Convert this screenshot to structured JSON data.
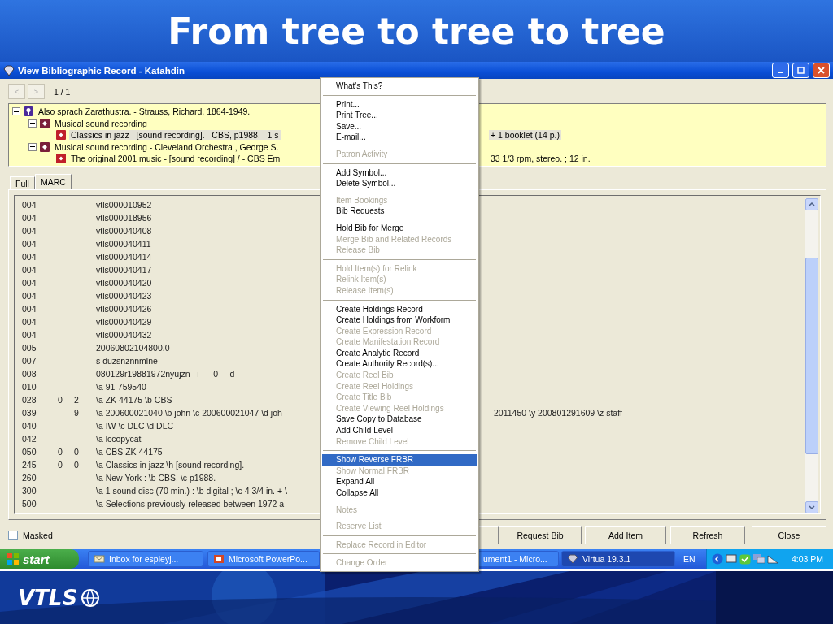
{
  "slide_title": "From tree to tree to tree",
  "window": {
    "title": "View Bibliographic Record - Katahdin"
  },
  "navigation": {
    "previous": "<",
    "next": ">",
    "position": "1 / 1"
  },
  "tree": [
    {
      "kind": "work",
      "text": "Also sprach Zarathustra. - Strauss, Richard, 1864-1949.",
      "expanded": true,
      "selected": false,
      "children": [
        {
          "kind": "expression",
          "text": "Musical sound recording",
          "expanded": true,
          "selected": false,
          "children": [
            {
              "kind": "manifestation",
              "text": "Classics in jazz   [sound recording].   CBS, p1988.   1 s",
              "continued_text": "+ 1 booklet (14 p.)",
              "selected": true
            }
          ]
        },
        {
          "kind": "expression",
          "text": "Musical sound recording - Cleveland Orchestra , George S.",
          "expanded": true,
          "selected": false,
          "children": [
            {
              "kind": "manifestation",
              "text": "The original 2001 music - [sound recording] / - CBS Em",
              "continued_text": "33 1/3 rpm, stereo. ; 12 in.",
              "selected": false
            }
          ]
        }
      ]
    }
  ],
  "tabs": [
    {
      "label": "Full",
      "selected": false
    },
    {
      "label": "MARC",
      "selected": true
    }
  ],
  "marc_rows": [
    {
      "tag": "004",
      "value": "vtls000010952"
    },
    {
      "tag": "004",
      "value": "vtls000018956"
    },
    {
      "tag": "004",
      "value": "vtls000040408"
    },
    {
      "tag": "004",
      "value": "vtls000040411"
    },
    {
      "tag": "004",
      "value": "vtls000040414"
    },
    {
      "tag": "004",
      "value": "vtls000040417"
    },
    {
      "tag": "004",
      "value": "vtls000040420"
    },
    {
      "tag": "004",
      "value": "vtls000040423"
    },
    {
      "tag": "004",
      "value": "vtls000040426"
    },
    {
      "tag": "004",
      "value": "vtls000040429"
    },
    {
      "tag": "004",
      "value": "vtls000040432"
    },
    {
      "tag": "005",
      "value": "20060802104800.0"
    },
    {
      "tag": "007",
      "value": "s duzsnznnmlne"
    },
    {
      "tag": "008",
      "value": "080129r19881972nyujzn   i      0     d"
    },
    {
      "tag": "010",
      "value": "\\a 91-759540"
    },
    {
      "tag": "028",
      "ind1": "0",
      "ind2": "2",
      "value": "\\a ZK 44175 \\b CBS"
    },
    {
      "tag": "039",
      "ind2": "9",
      "value": "\\a 200600021040 \\b john \\c 200600021047 \\d joh",
      "continued_value": "2011450 \\y 200801291609 \\z staff"
    },
    {
      "tag": "040",
      "value": "\\a IW \\c DLC \\d DLC"
    },
    {
      "tag": "042",
      "value": "\\a lccopycat"
    },
    {
      "tag": "050",
      "ind1": "0",
      "ind2": "0",
      "value": "\\a CBS ZK 44175"
    },
    {
      "tag": "245",
      "ind1": "0",
      "ind2": "0",
      "value": "\\a Classics in jazz \\h [sound recording]."
    },
    {
      "tag": "260",
      "value": "\\a New York : \\b CBS, \\c p1988."
    },
    {
      "tag": "300",
      "value": "\\a 1 sound disc (70 min.) : \\b digital ; \\c 4 3/4 in. + \\"
    },
    {
      "tag": "500",
      "value": "\\a Selections previously released between 1972 a"
    }
  ],
  "masked": {
    "label": "Masked",
    "checked": false
  },
  "buttons": [
    "Request Bib",
    "Add Item",
    "Refresh",
    "Close"
  ],
  "context_menu": [
    {
      "kind": "item",
      "label": "What's This?",
      "disabled": false,
      "selected": false
    },
    {
      "kind": "separator"
    },
    {
      "kind": "item",
      "label": "Print...",
      "disabled": false,
      "selected": false
    },
    {
      "kind": "item",
      "label": "Print Tree...",
      "disabled": false,
      "selected": false
    },
    {
      "kind": "item",
      "label": "Save...",
      "disabled": false,
      "selected": false
    },
    {
      "kind": "item",
      "label": "E-mail...",
      "disabled": false,
      "selected": false
    },
    {
      "kind": "gap"
    },
    {
      "kind": "item",
      "label": "Patron Activity",
      "disabled": true,
      "selected": false
    },
    {
      "kind": "separator"
    },
    {
      "kind": "item",
      "label": "Add Symbol...",
      "disabled": false,
      "selected": false
    },
    {
      "kind": "item",
      "label": "Delete Symbol...",
      "disabled": false,
      "selected": false
    },
    {
      "kind": "gap"
    },
    {
      "kind": "item",
      "label": "Item Bookings",
      "disabled": true,
      "selected": false
    },
    {
      "kind": "item",
      "label": "Bib Requests",
      "disabled": false,
      "selected": false
    },
    {
      "kind": "gap"
    },
    {
      "kind": "item",
      "label": "Hold Bib for Merge",
      "disabled": false,
      "selected": false
    },
    {
      "kind": "item",
      "label": "Merge Bib and Related Records",
      "disabled": true,
      "selected": false
    },
    {
      "kind": "item",
      "label": "Release Bib",
      "disabled": true,
      "selected": false
    },
    {
      "kind": "separator"
    },
    {
      "kind": "item",
      "label": "Hold Item(s) for Relink",
      "disabled": true,
      "selected": false
    },
    {
      "kind": "item",
      "label": "Relink Item(s)",
      "disabled": true,
      "selected": false
    },
    {
      "kind": "item",
      "label": "Release Item(s)",
      "disabled": true,
      "selected": false
    },
    {
      "kind": "separator"
    },
    {
      "kind": "item",
      "label": "Create Holdings Record",
      "disabled": false,
      "selected": false
    },
    {
      "kind": "item",
      "label": "Create Holdings from Workform",
      "disabled": false,
      "selected": false
    },
    {
      "kind": "item",
      "label": "Create Expression Record",
      "disabled": true,
      "selected": false
    },
    {
      "kind": "item",
      "label": "Create Manifestation Record",
      "disabled": true,
      "selected": false
    },
    {
      "kind": "item",
      "label": "Create Analytic Record",
      "disabled": false,
      "selected": false
    },
    {
      "kind": "item",
      "label": "Create Authority Record(s)...",
      "disabled": false,
      "selected": false
    },
    {
      "kind": "item",
      "label": "Create Reel Bib",
      "disabled": true,
      "selected": false
    },
    {
      "kind": "item",
      "label": "Create Reel Holdings",
      "disabled": true,
      "selected": false
    },
    {
      "kind": "item",
      "label": "Create Title Bib",
      "disabled": true,
      "selected": false
    },
    {
      "kind": "item",
      "label": "Create Viewing Reel Holdings",
      "disabled": true,
      "selected": false
    },
    {
      "kind": "item",
      "label": "Save Copy to Database",
      "disabled": false,
      "selected": false
    },
    {
      "kind": "item",
      "label": "Add Child Level",
      "disabled": false,
      "selected": false
    },
    {
      "kind": "item",
      "label": "Remove Child Level",
      "disabled": true,
      "selected": false
    },
    {
      "kind": "separator"
    },
    {
      "kind": "item",
      "label": "Show Reverse FRBR",
      "disabled": false,
      "selected": true
    },
    {
      "kind": "item",
      "label": "Show Normal FRBR",
      "disabled": true,
      "selected": false
    },
    {
      "kind": "item",
      "label": "Expand All",
      "disabled": false,
      "selected": false
    },
    {
      "kind": "item",
      "label": "Collapse All",
      "disabled": false,
      "selected": false
    },
    {
      "kind": "gap"
    },
    {
      "kind": "item",
      "label": "Notes",
      "disabled": true,
      "selected": false
    },
    {
      "kind": "gap"
    },
    {
      "kind": "item",
      "label": "Reserve List",
      "disabled": true,
      "selected": false
    },
    {
      "kind": "separator"
    },
    {
      "kind": "item",
      "label": "Replace Record in Editor",
      "disabled": true,
      "selected": false
    },
    {
      "kind": "separator"
    },
    {
      "kind": "item",
      "label": "Change Order",
      "disabled": true,
      "selected": false
    }
  ],
  "taskbar": {
    "start": "start",
    "tasks": [
      {
        "label": "Inbox for espleyj...",
        "selected": false
      },
      {
        "label": "Microsoft PowerPo...",
        "selected": false
      },
      {
        "label": "ument1 - Micro...",
        "selected": false
      },
      {
        "label": "Virtua 19.3.1",
        "selected": true
      }
    ],
    "language": "EN",
    "clock": "4:03 PM"
  },
  "footer": {
    "logo": "VTLS"
  }
}
